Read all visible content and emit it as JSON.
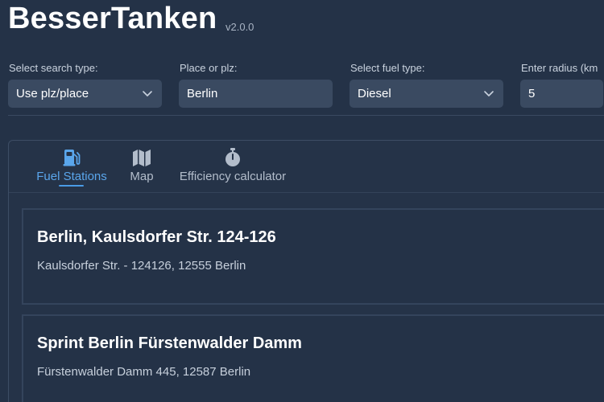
{
  "app": {
    "title": "BesserTanken",
    "version": "v2.0.0"
  },
  "controls": {
    "search_type": {
      "label": "Select search type:",
      "value": "Use plz/place"
    },
    "place": {
      "label": "Place or plz:",
      "value": "Berlin"
    },
    "fuel_type": {
      "label": "Select fuel type:",
      "value": "Diesel"
    },
    "radius": {
      "label": "Enter radius (km",
      "value": "5"
    }
  },
  "tabs": [
    {
      "label": "Fuel Stations",
      "icon": "fuel-pump-icon",
      "active": true
    },
    {
      "label": "Map",
      "icon": "map-icon",
      "active": false
    },
    {
      "label": "Efficiency calculator",
      "icon": "stopwatch-icon",
      "active": false
    }
  ],
  "stations": [
    {
      "name": "Berlin, Kaulsdorfer Str. 124-126",
      "address": "Kaulsdorfer Str. - 124126, 12555 Berlin"
    },
    {
      "name": "Sprint Berlin Fürstenwalder Damm",
      "address": "Fürstenwalder Damm 445, 12587 Berlin"
    }
  ],
  "colors": {
    "background": "#243247",
    "input_background": "#3a4a61",
    "accent": "#5aa6ec"
  }
}
